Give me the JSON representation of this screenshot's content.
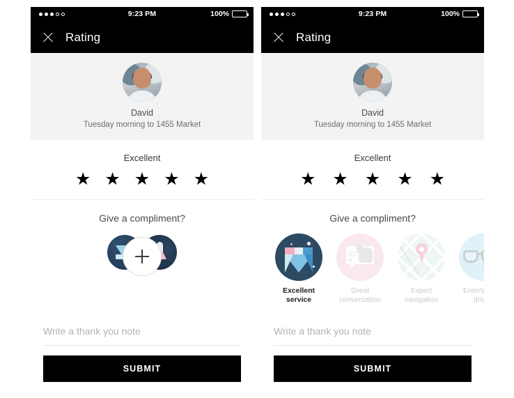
{
  "statusbar": {
    "time": "9:23 PM",
    "battery_percent": "100%",
    "signal_filled": 3,
    "signal_empty": 2
  },
  "navbar": {
    "title": "Rating",
    "close_icon": "close-icon"
  },
  "profile": {
    "name": "David",
    "trip": "Tuesday morning to 1455 Market",
    "avatar_icon": "avatar"
  },
  "rating": {
    "label": "Excellent",
    "stars_total": 5,
    "stars_filled": 5,
    "star_glyph": "★"
  },
  "compliment": {
    "title": "Give a compliment?",
    "add_button_icon": "plus-icon",
    "cards": [
      {
        "label_line1": "Excellent",
        "label_line2": "service",
        "icon": "diamond-icon",
        "selected": true
      },
      {
        "label_line1": "Great",
        "label_line2": "conversation",
        "icon": "thumbs-up-icon",
        "selected": false
      },
      {
        "label_line1": "Expert",
        "label_line2": "navigation",
        "icon": "map-pin-icon",
        "selected": false
      },
      {
        "label_line1": "Entertaining",
        "label_line2": "driver",
        "icon": "glasses-icon",
        "selected": false
      }
    ]
  },
  "note": {
    "placeholder": "Write a thank you note",
    "value": ""
  },
  "submit": {
    "label": "SUBMIT"
  },
  "colors": {
    "bar": "#000000",
    "card_bg": "#f3f3f4",
    "selected_badge": "#2d4a63",
    "pink": "#f3cdd8",
    "mint": "#d9ece3",
    "blue": "#b9e3ee",
    "muted_text": "#c9c9c9"
  }
}
